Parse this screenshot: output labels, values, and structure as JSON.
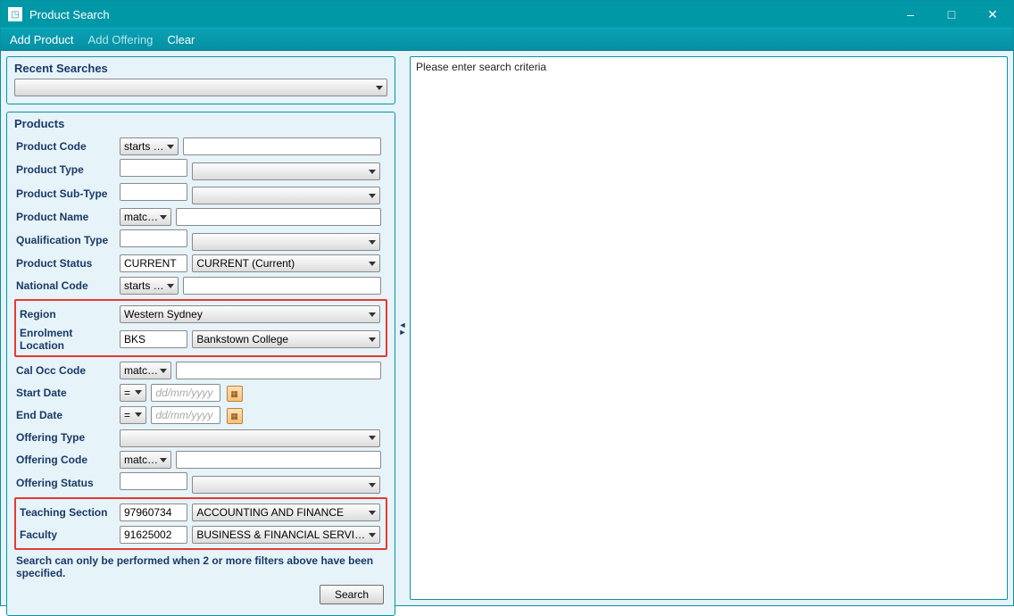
{
  "window": {
    "title": "Product Search"
  },
  "menu": {
    "add_product": "Add Product",
    "add_offering": "Add Offering",
    "clear": "Clear"
  },
  "recent": {
    "title": "Recent Searches"
  },
  "products": {
    "title": "Products",
    "labels": {
      "product_code": "Product Code",
      "product_type": "Product Type",
      "product_subtype": "Product Sub-Type",
      "product_name": "Product Name",
      "qualification_type": "Qualification Type",
      "product_status": "Product Status",
      "national_code": "National Code",
      "region": "Region",
      "enrolment_location": "Enrolment Location",
      "cal_occ_code": "Cal Occ Code",
      "start_date": "Start Date",
      "end_date": "End Date",
      "offering_type": "Offering Type",
      "offering_code": "Offering Code",
      "offering_status": "Offering Status",
      "teaching_section": "Teaching Section",
      "faculty": "Faculty"
    },
    "ops": {
      "starts_with": "starts with",
      "matches": "matches",
      "eq": "="
    },
    "values": {
      "product_status_code": "CURRENT",
      "product_status_desc": "CURRENT (Current)",
      "region": "Western Sydney",
      "enrolment_loc_code": "BKS",
      "enrolment_loc_desc": "Bankstown College",
      "teaching_section_code": "97960734",
      "teaching_section_desc": "ACCOUNTING AND FINANCE",
      "faculty_code": "91625002",
      "faculty_desc": "BUSINESS & FINANCIAL SERVICES",
      "date_placeholder": "dd/mm/yyyy"
    }
  },
  "help_text": "Search can only be performed when 2 or more filters above have been specified.",
  "search_button": "Search",
  "right_panel_msg": "Please enter search criteria"
}
